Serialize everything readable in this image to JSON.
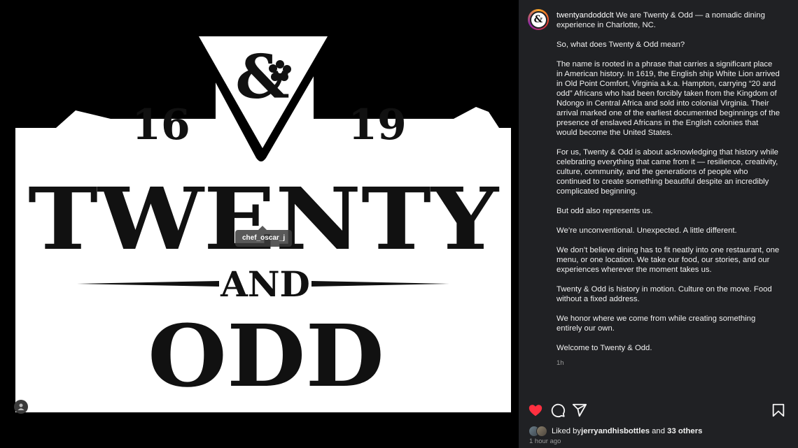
{
  "poster": {
    "year_left": "16",
    "year_right": "19",
    "word_twenty": "TWENTY",
    "word_and": "AND",
    "word_odd": "ODD",
    "logo_glyph": "&"
  },
  "tag": {
    "username": "chef_oscar_j"
  },
  "post": {
    "username": "twentyandoddclt",
    "avatar_glyph": "&",
    "caption_first": "We are Twenty & Odd — a nomadic dining experience in Charlotte, NC.",
    "paragraphs": [
      "So, what does Twenty & Odd mean?",
      "The name is rooted in a phrase that carries a significant place in American history. In 1619, the English ship White Lion arrived in Old Point Comfort, Virginia a.k.a. Hampton, carrying “20 and odd” Africans who had been forcibly taken from the Kingdom of Ndongo in Central Africa and sold into colonial Virginia. Their arrival marked one of the earliest documented beginnings of the presence of enslaved Africans in the English colonies that would become the United States.",
      "For us, Twenty & Odd is about acknowledging that history while celebrating everything that came from it — resilience, creativity, culture, community, and the generations of people who continued to create something beautiful despite an incredibly complicated beginning.",
      "But odd also represents us.",
      "We’re unconventional. Unexpected. A little different.",
      "We don’t believe dining has to fit neatly into one restaurant, one menu, or one location. We take our food, our stories, and our experiences wherever the moment takes us.",
      "Twenty & Odd is history in motion. Culture on the move. Food without a fixed address.",
      "We honor where we come from while creating something entirely our own.",
      "Welcome to Twenty & Odd."
    ],
    "caption_time": "1h",
    "liked_by_prefix": "Liked by ",
    "liked_by_user": "jerryandhisbottles",
    "liked_by_and": " and ",
    "liked_by_others": "33 others",
    "posted_time": "1 hour ago"
  },
  "icons": {
    "like": "heart-icon",
    "comment": "comment-icon",
    "share": "share-icon",
    "save": "bookmark-icon",
    "tag": "person-icon"
  },
  "colors": {
    "like_active": "#ff3040",
    "panel_bg": "#202124"
  }
}
